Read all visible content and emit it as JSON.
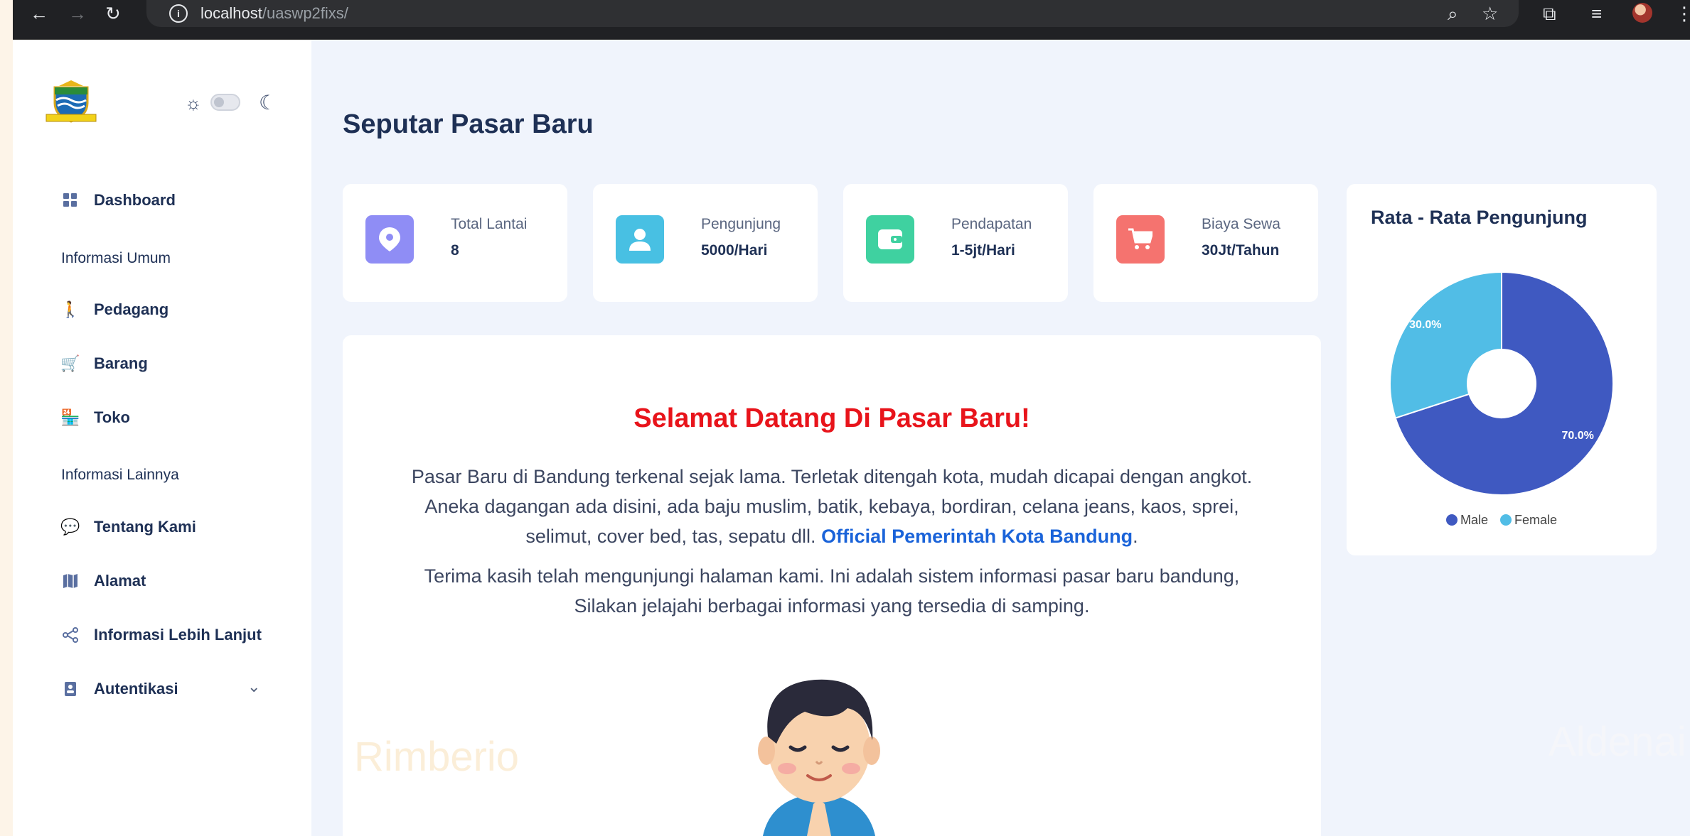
{
  "browser": {
    "url_host": "localhost",
    "url_path": "/uaswp2fixs/"
  },
  "sidebar": {
    "items": [
      {
        "label": "Dashboard",
        "icon": "dashboard-icon"
      },
      {
        "label": "Pedagang",
        "icon": "person-icon"
      },
      {
        "label": "Barang",
        "icon": "cart-icon"
      },
      {
        "label": "Toko",
        "icon": "store-icon"
      },
      {
        "label": "Tentang Kami",
        "icon": "chat-icon"
      },
      {
        "label": "Alamat",
        "icon": "map-icon"
      },
      {
        "label": "Informasi Lebih Lanjut",
        "icon": "share-icon"
      },
      {
        "label": "Autentikasi",
        "icon": "lock-icon"
      }
    ],
    "headings": [
      "Informasi Umum",
      "Informasi Lainnya"
    ]
  },
  "main": {
    "title": "Seputar Pasar Baru",
    "stats": [
      {
        "label": "Total Lantai",
        "value": "8",
        "color": "#8f8df5"
      },
      {
        "label": "Pengunjung",
        "value": "5000/Hari",
        "color": "#48c0e3"
      },
      {
        "label": "Pendapatan",
        "value": "1-5jt/Hari",
        "color": "#3fd1a0"
      },
      {
        "label": "Biaya Sewa",
        "value": "30Jt/Tahun",
        "color": "#f5736f"
      }
    ],
    "welcome": {
      "heading": "Selamat Datang Di Pasar Baru!",
      "para1": "Pasar Baru di Bandung terkenal sejak lama. Terletak ditengah kota, mudah dicapai dengan angkot. Aneka dagangan ada disini, ada baju muslim, batik, kebaya, bordiran, celana jeans, kaos, sprei, selimut, cover bed, tas, sepatu dll.",
      "link": "Official Pemerintah Kota Bandung",
      "para1_end": ".",
      "para2": "Terima kasih telah mengunjungi halaman kami. Ini adalah sistem informasi pasar baru bandung, Silakan jelajahi berbagai informasi yang tersedia di samping.",
      "watermark": "Rimberio"
    },
    "watermark2": "Aldenai"
  },
  "chart_data": {
    "type": "pie",
    "title": "Rata - Rata Pengunjung",
    "categories": [
      "Male",
      "Female"
    ],
    "values": [
      70.0,
      30.0
    ],
    "labels": [
      "70.0%",
      "30.0%"
    ],
    "colors": [
      "#3f59c1",
      "#51bde6"
    ],
    "legend": "bottom",
    "donut": true
  }
}
